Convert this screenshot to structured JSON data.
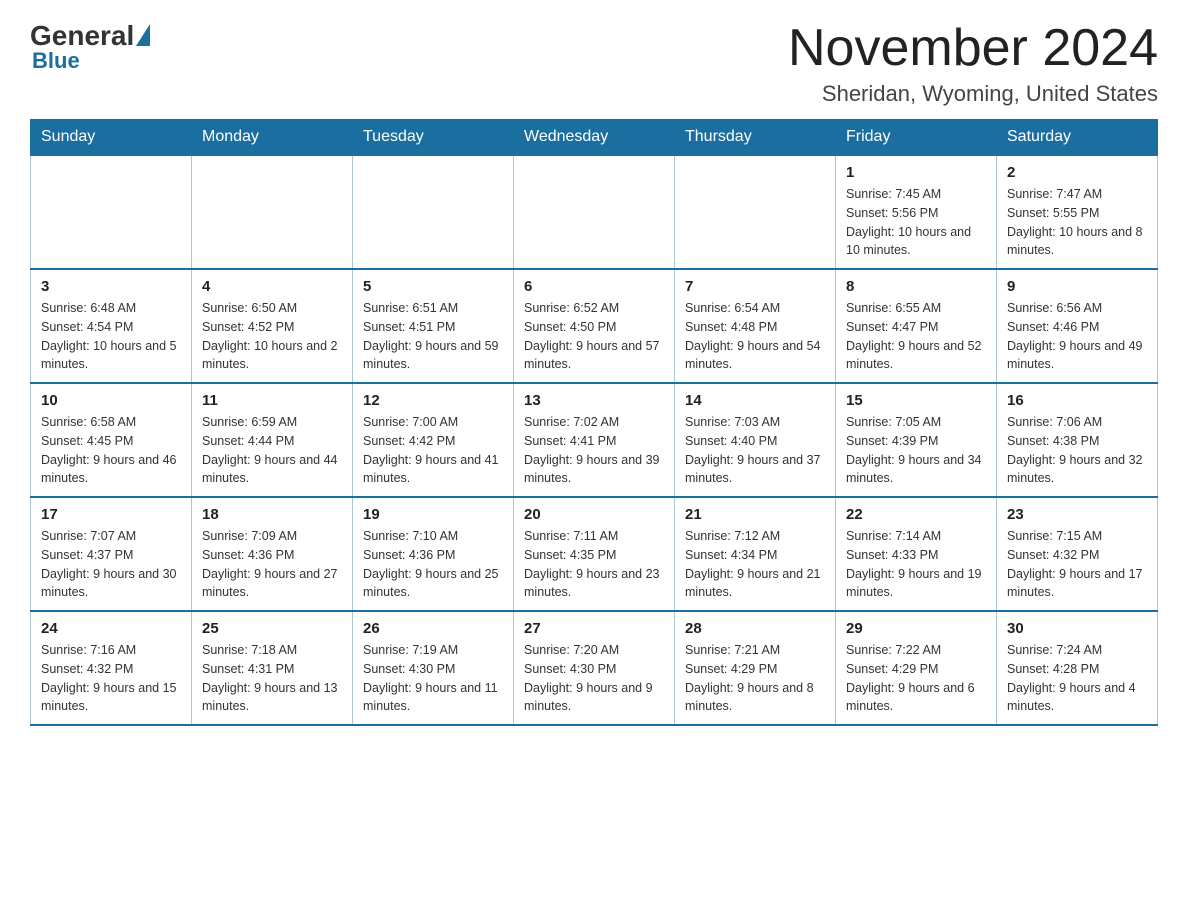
{
  "header": {
    "logo_general": "General",
    "logo_blue": "Blue",
    "month_title": "November 2024",
    "location": "Sheridan, Wyoming, United States"
  },
  "weekdays": [
    "Sunday",
    "Monday",
    "Tuesday",
    "Wednesday",
    "Thursday",
    "Friday",
    "Saturday"
  ],
  "weeks": [
    [
      {
        "day": "",
        "sunrise": "",
        "sunset": "",
        "daylight": ""
      },
      {
        "day": "",
        "sunrise": "",
        "sunset": "",
        "daylight": ""
      },
      {
        "day": "",
        "sunrise": "",
        "sunset": "",
        "daylight": ""
      },
      {
        "day": "",
        "sunrise": "",
        "sunset": "",
        "daylight": ""
      },
      {
        "day": "",
        "sunrise": "",
        "sunset": "",
        "daylight": ""
      },
      {
        "day": "1",
        "sunrise": "Sunrise: 7:45 AM",
        "sunset": "Sunset: 5:56 PM",
        "daylight": "Daylight: 10 hours and 10 minutes."
      },
      {
        "day": "2",
        "sunrise": "Sunrise: 7:47 AM",
        "sunset": "Sunset: 5:55 PM",
        "daylight": "Daylight: 10 hours and 8 minutes."
      }
    ],
    [
      {
        "day": "3",
        "sunrise": "Sunrise: 6:48 AM",
        "sunset": "Sunset: 4:54 PM",
        "daylight": "Daylight: 10 hours and 5 minutes."
      },
      {
        "day": "4",
        "sunrise": "Sunrise: 6:50 AM",
        "sunset": "Sunset: 4:52 PM",
        "daylight": "Daylight: 10 hours and 2 minutes."
      },
      {
        "day": "5",
        "sunrise": "Sunrise: 6:51 AM",
        "sunset": "Sunset: 4:51 PM",
        "daylight": "Daylight: 9 hours and 59 minutes."
      },
      {
        "day": "6",
        "sunrise": "Sunrise: 6:52 AM",
        "sunset": "Sunset: 4:50 PM",
        "daylight": "Daylight: 9 hours and 57 minutes."
      },
      {
        "day": "7",
        "sunrise": "Sunrise: 6:54 AM",
        "sunset": "Sunset: 4:48 PM",
        "daylight": "Daylight: 9 hours and 54 minutes."
      },
      {
        "day": "8",
        "sunrise": "Sunrise: 6:55 AM",
        "sunset": "Sunset: 4:47 PM",
        "daylight": "Daylight: 9 hours and 52 minutes."
      },
      {
        "day": "9",
        "sunrise": "Sunrise: 6:56 AM",
        "sunset": "Sunset: 4:46 PM",
        "daylight": "Daylight: 9 hours and 49 minutes."
      }
    ],
    [
      {
        "day": "10",
        "sunrise": "Sunrise: 6:58 AM",
        "sunset": "Sunset: 4:45 PM",
        "daylight": "Daylight: 9 hours and 46 minutes."
      },
      {
        "day": "11",
        "sunrise": "Sunrise: 6:59 AM",
        "sunset": "Sunset: 4:44 PM",
        "daylight": "Daylight: 9 hours and 44 minutes."
      },
      {
        "day": "12",
        "sunrise": "Sunrise: 7:00 AM",
        "sunset": "Sunset: 4:42 PM",
        "daylight": "Daylight: 9 hours and 41 minutes."
      },
      {
        "day": "13",
        "sunrise": "Sunrise: 7:02 AM",
        "sunset": "Sunset: 4:41 PM",
        "daylight": "Daylight: 9 hours and 39 minutes."
      },
      {
        "day": "14",
        "sunrise": "Sunrise: 7:03 AM",
        "sunset": "Sunset: 4:40 PM",
        "daylight": "Daylight: 9 hours and 37 minutes."
      },
      {
        "day": "15",
        "sunrise": "Sunrise: 7:05 AM",
        "sunset": "Sunset: 4:39 PM",
        "daylight": "Daylight: 9 hours and 34 minutes."
      },
      {
        "day": "16",
        "sunrise": "Sunrise: 7:06 AM",
        "sunset": "Sunset: 4:38 PM",
        "daylight": "Daylight: 9 hours and 32 minutes."
      }
    ],
    [
      {
        "day": "17",
        "sunrise": "Sunrise: 7:07 AM",
        "sunset": "Sunset: 4:37 PM",
        "daylight": "Daylight: 9 hours and 30 minutes."
      },
      {
        "day": "18",
        "sunrise": "Sunrise: 7:09 AM",
        "sunset": "Sunset: 4:36 PM",
        "daylight": "Daylight: 9 hours and 27 minutes."
      },
      {
        "day": "19",
        "sunrise": "Sunrise: 7:10 AM",
        "sunset": "Sunset: 4:36 PM",
        "daylight": "Daylight: 9 hours and 25 minutes."
      },
      {
        "day": "20",
        "sunrise": "Sunrise: 7:11 AM",
        "sunset": "Sunset: 4:35 PM",
        "daylight": "Daylight: 9 hours and 23 minutes."
      },
      {
        "day": "21",
        "sunrise": "Sunrise: 7:12 AM",
        "sunset": "Sunset: 4:34 PM",
        "daylight": "Daylight: 9 hours and 21 minutes."
      },
      {
        "day": "22",
        "sunrise": "Sunrise: 7:14 AM",
        "sunset": "Sunset: 4:33 PM",
        "daylight": "Daylight: 9 hours and 19 minutes."
      },
      {
        "day": "23",
        "sunrise": "Sunrise: 7:15 AM",
        "sunset": "Sunset: 4:32 PM",
        "daylight": "Daylight: 9 hours and 17 minutes."
      }
    ],
    [
      {
        "day": "24",
        "sunrise": "Sunrise: 7:16 AM",
        "sunset": "Sunset: 4:32 PM",
        "daylight": "Daylight: 9 hours and 15 minutes."
      },
      {
        "day": "25",
        "sunrise": "Sunrise: 7:18 AM",
        "sunset": "Sunset: 4:31 PM",
        "daylight": "Daylight: 9 hours and 13 minutes."
      },
      {
        "day": "26",
        "sunrise": "Sunrise: 7:19 AM",
        "sunset": "Sunset: 4:30 PM",
        "daylight": "Daylight: 9 hours and 11 minutes."
      },
      {
        "day": "27",
        "sunrise": "Sunrise: 7:20 AM",
        "sunset": "Sunset: 4:30 PM",
        "daylight": "Daylight: 9 hours and 9 minutes."
      },
      {
        "day": "28",
        "sunrise": "Sunrise: 7:21 AM",
        "sunset": "Sunset: 4:29 PM",
        "daylight": "Daylight: 9 hours and 8 minutes."
      },
      {
        "day": "29",
        "sunrise": "Sunrise: 7:22 AM",
        "sunset": "Sunset: 4:29 PM",
        "daylight": "Daylight: 9 hours and 6 minutes."
      },
      {
        "day": "30",
        "sunrise": "Sunrise: 7:24 AM",
        "sunset": "Sunset: 4:28 PM",
        "daylight": "Daylight: 9 hours and 4 minutes."
      }
    ]
  ]
}
